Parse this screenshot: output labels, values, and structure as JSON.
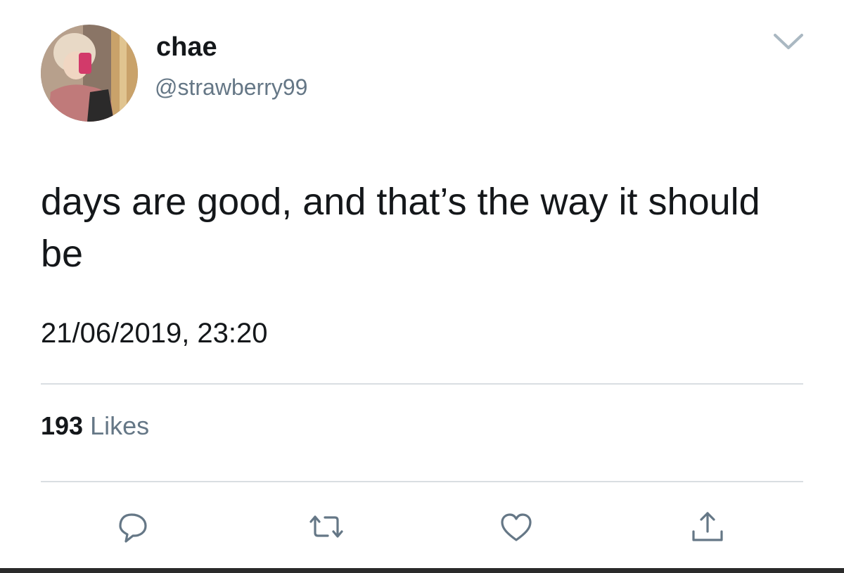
{
  "author": {
    "display_name": "chae",
    "handle": "@strawberry99"
  },
  "tweet": {
    "text": "days are good, and that’s the way it should be",
    "timestamp": "21/06/2019, 23:20"
  },
  "stats": {
    "likes_count": "193",
    "likes_label": "Likes"
  },
  "icons": {
    "menu": "chevron-down-icon",
    "reply": "reply-icon",
    "retweet": "retweet-icon",
    "like": "heart-icon",
    "share": "share-icon"
  },
  "colors": {
    "text_primary": "#14171a",
    "text_secondary": "#657786",
    "icon": "#657786",
    "divider": "#d9dee2"
  }
}
